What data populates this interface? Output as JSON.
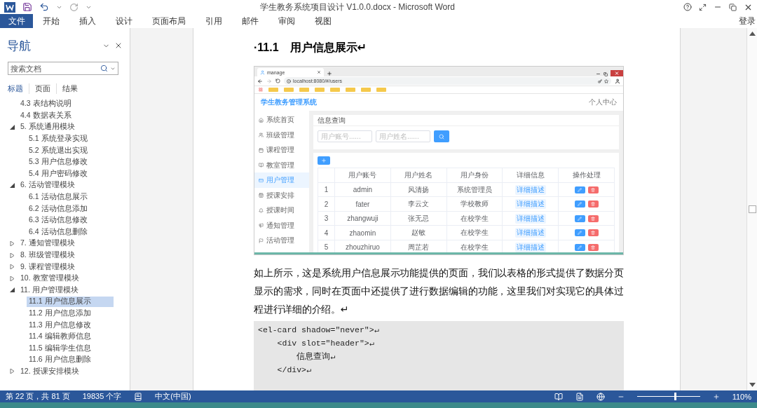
{
  "window": {
    "title": "学生教务系统项目设计 V1.0.0.docx - Microsoft Word"
  },
  "ribbon": {
    "tabs": [
      {
        "label": "文件",
        "kind": "file"
      },
      {
        "label": "开始",
        "kind": "tab"
      },
      {
        "label": "插入",
        "kind": "tab"
      },
      {
        "label": "设计",
        "kind": "tab"
      },
      {
        "label": "页面布局",
        "kind": "tab"
      },
      {
        "label": "引用",
        "kind": "tab"
      },
      {
        "label": "邮件",
        "kind": "tab"
      },
      {
        "label": "审阅",
        "kind": "tab"
      },
      {
        "label": "视图",
        "kind": "tab"
      }
    ],
    "signin": "登录"
  },
  "navigation": {
    "title": "导航",
    "search": {
      "placeholder": "搜索文档"
    },
    "tabs": [
      {
        "label": "标题",
        "selected": true
      },
      {
        "label": "页面",
        "selected": false
      },
      {
        "label": "结果",
        "selected": false
      }
    ],
    "items": [
      {
        "children": [
          {
            "label": "4.3 表结构说明",
            "selected": false
          },
          {
            "label": "4.4 数据表关系",
            "selected": false
          }
        ]
      },
      {
        "label": "5. 系统通用模块",
        "expanded": true,
        "selected": false,
        "children": [
          {
            "label": "5.1 系统登录实现",
            "selected": false
          },
          {
            "label": "5.2 系统退出实现",
            "selected": false
          },
          {
            "label": "5.3 用户信息修改",
            "selected": false
          },
          {
            "label": "5.4 用户密码修改",
            "selected": false
          }
        ]
      },
      {
        "label": "6. 活动管理模块",
        "expanded": true,
        "selected": false,
        "children": [
          {
            "label": "6.1 活动信息展示",
            "selected": false
          },
          {
            "label": "6.2 活动信息添加",
            "selected": false
          },
          {
            "label": "6.3 活动信息修改",
            "selected": false
          },
          {
            "label": "6.4 活动信息删除",
            "selected": false
          }
        ]
      },
      {
        "label": "7. 通知管理模块",
        "expanded": false,
        "selected": false
      },
      {
        "label": "8. 班级管理模块",
        "expanded": false,
        "selected": false
      },
      {
        "label": "9. 课程管理模块",
        "expanded": false,
        "selected": false
      },
      {
        "label": "10. 教室管理模块",
        "expanded": false,
        "selected": false
      },
      {
        "label": "11. 用户管理模块",
        "expanded": true,
        "selected": false,
        "children": [
          {
            "label": "11.1 用户信息展示",
            "selected": true
          },
          {
            "label": "11.2 用户信息添加",
            "selected": false
          },
          {
            "label": "11.3 用户信息修改",
            "selected": false
          },
          {
            "label": "11.4 编辑教师信息",
            "selected": false
          },
          {
            "label": "11.5 编辑学生信息",
            "selected": false
          },
          {
            "label": "11.6 用户信息删除",
            "selected": false
          }
        ]
      },
      {
        "label": "12. 授课安排模块",
        "expanded": false,
        "selected": false
      }
    ]
  },
  "document": {
    "heading": {
      "number": "·11.1",
      "text": "用户信息展示↵"
    },
    "figure": {
      "browser": {
        "tab": "manage",
        "url": "localhost:8080/#/users"
      },
      "app": {
        "title": "学生教务管理系统",
        "user_menu": "个人中心",
        "menu": [
          {
            "label": "系统首页",
            "selected": false
          },
          {
            "label": "班级管理",
            "selected": false
          },
          {
            "label": "课程管理",
            "selected": false
          },
          {
            "label": "教室管理",
            "selected": false
          },
          {
            "label": "用户管理",
            "selected": true
          },
          {
            "label": "授课安排",
            "selected": false
          },
          {
            "label": "授课时间",
            "selected": false
          },
          {
            "label": "通知管理",
            "selected": false
          },
          {
            "label": "活动管理",
            "selected": false
          }
        ],
        "query": {
          "title": "信息查询",
          "fields": [
            {
              "placeholder": "用户账号......"
            },
            {
              "placeholder": "用户姓名......"
            }
          ]
        },
        "table": {
          "columns": [
            "",
            "用户账号",
            "用户姓名",
            "用户身份",
            "详细信息",
            "操作处理"
          ],
          "rows": [
            {
              "index": "1",
              "account": "admin",
              "name": "风清扬",
              "role": "系统管理员",
              "detail": "详细描述"
            },
            {
              "index": "2",
              "account": "fater",
              "name": "李云文",
              "role": "学校教师",
              "detail": "详细描述"
            },
            {
              "index": "3",
              "account": "zhangwuji",
              "name": "张无忌",
              "role": "在校学生",
              "detail": "详细描述"
            },
            {
              "index": "4",
              "account": "zhaomin",
              "name": "赵敏",
              "role": "在校学生",
              "detail": "详细描述"
            },
            {
              "index": "5",
              "account": "zhouzhiruo",
              "name": "周芷若",
              "role": "在校学生",
              "detail": "详细描述"
            }
          ]
        }
      }
    },
    "paragraph": "如上所示，这是系统用户信息展示功能提供的页面，我们以表格的形式提供了数据分页显示的需求，同时在页面中还提供了进行数据编辑的功能，这里我们对实现它的具体过程进行详细的介绍。↵",
    "code": [
      "<el-card shadow=\"never\">↵",
      "    <div slot=\"header\">↵",
      "        信息查询↵",
      "    </div>↵"
    ]
  },
  "status_bar": {
    "page": "第 22 页，共 81 页",
    "words": "19835 个字",
    "language": "中文(中国)",
    "zoom": {
      "level": 0.6,
      "reading": "110%"
    }
  }
}
